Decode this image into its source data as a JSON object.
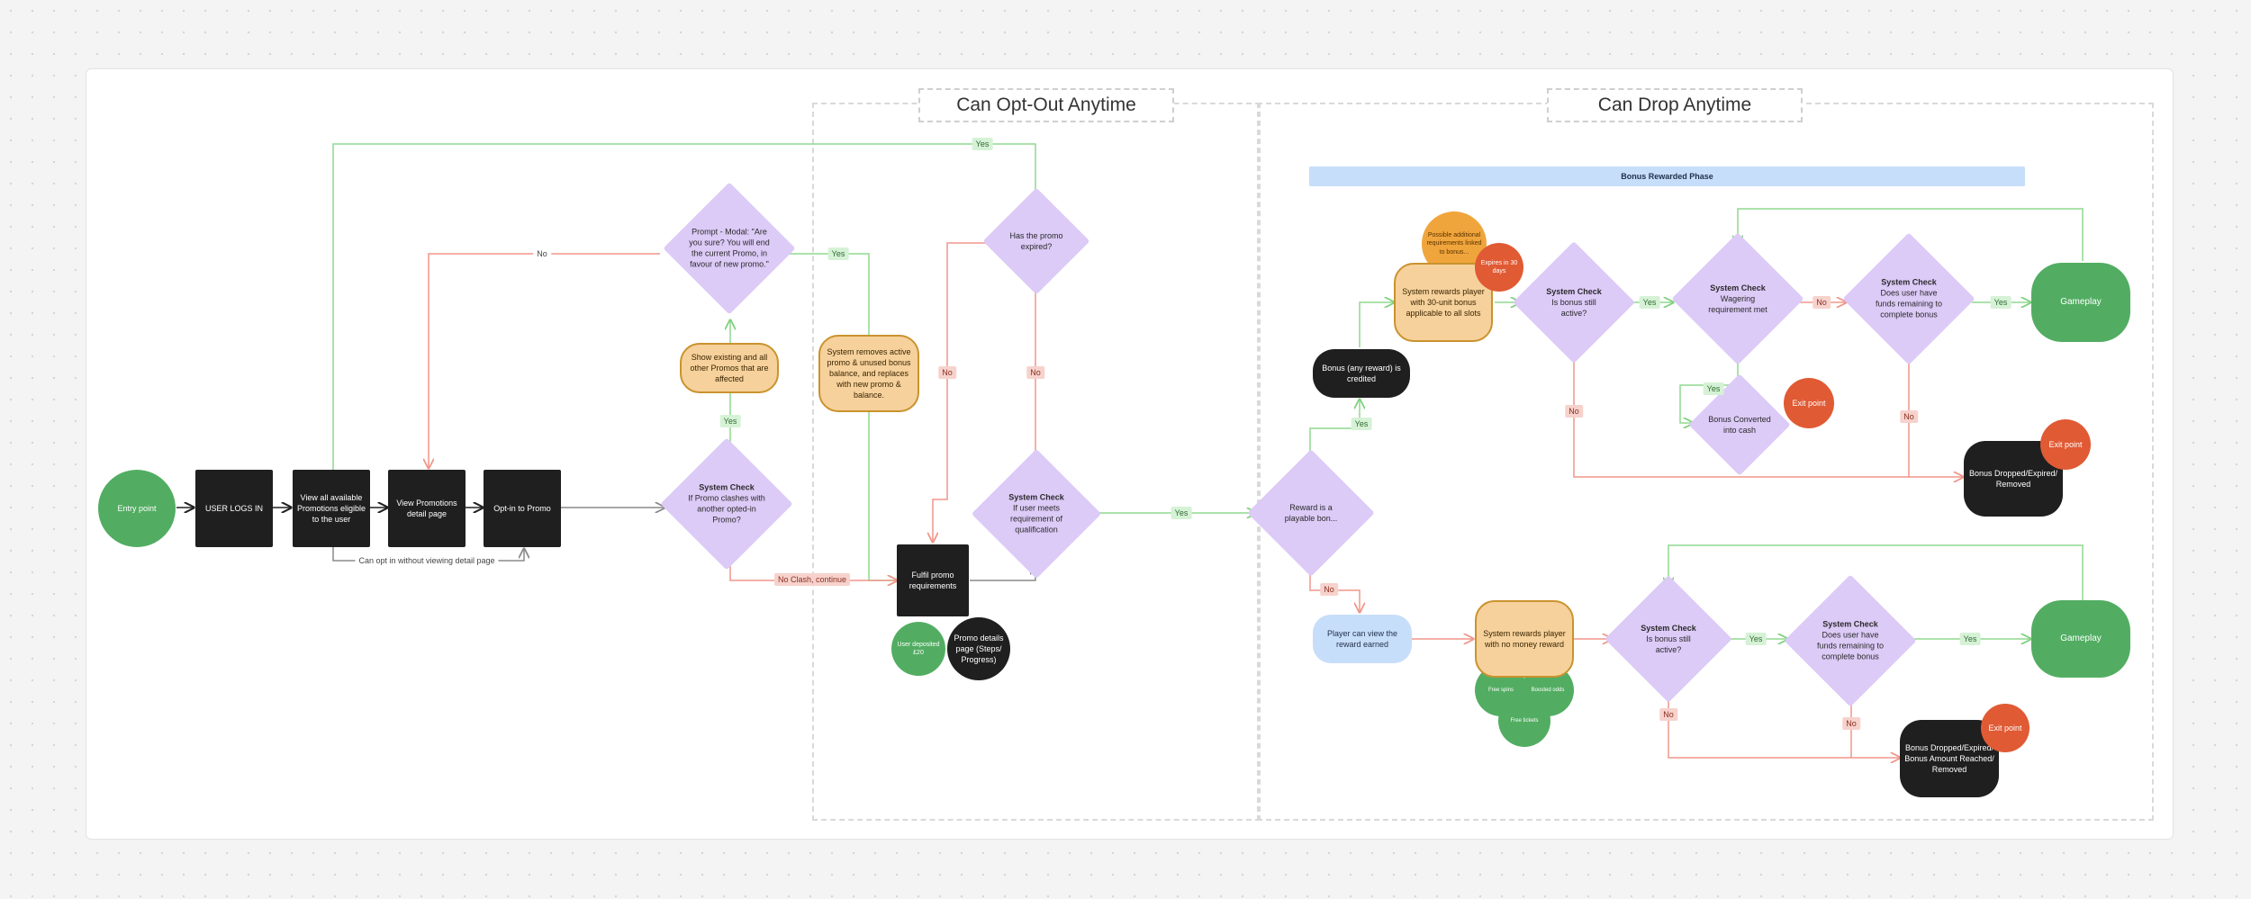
{
  "zones": {
    "optout": "Can Opt-Out Anytime",
    "drop": "Can Drop Anytime",
    "banner": "Bonus Rewarded Phase"
  },
  "nodes": {
    "entry": "Entry point",
    "login": "USER LOGS IN",
    "view_all": "View all available Promotions eligible to the user",
    "view_details": "View Promotions detail page",
    "optin": "Opt-in to Promo",
    "show_existing": "Show existing and all other Promos that are affected",
    "system_removes": "System removes active promo & unused bonus balance, and replaces with new promo & balance.",
    "fulfil": "Fulfil promo requirements",
    "user_deposited": "User deposited £20",
    "promo_details": "Promo details page (Steps/ Progress)",
    "bonus_credited": "Bonus (any reward) is credited",
    "possible_req": "Possible additional requirements linked to bonus...",
    "expires": "Expires in 30 days",
    "rewards_bonus": "System rewards player with 30-unit bonus applicable to all slots",
    "bonus_converted": "Bonus Converted into cash",
    "exit1": "Exit point",
    "gameplay1": "Gameplay",
    "dropped1": "Bonus Dropped/Expired/ Removed",
    "exit2": "Exit point",
    "player_view": "Player can view the reward earned",
    "rewards_nomoney": "System rewards player with no money reward",
    "free_spins": "Free spins",
    "boosted_odds": "Boosted odds",
    "free_tickets": "Free tickets",
    "gameplay2": "Gameplay",
    "dropped2": "Bonus Dropped/Expired/ Bonus Amount Reached/ Removed",
    "exit3": "Exit point"
  },
  "diamonds": {
    "prompt": "Prompt - Modal: \"Are you sure? You will end the current Promo, in favour of new promo.\"",
    "clash_title": "System Check",
    "clash": "If Promo clashes with another opted-in Promo?",
    "expired": "Has the promo expired?",
    "qual_title": "System Check",
    "qual": "If user meets requirement of qualification",
    "playable": "Reward is a playable bon...",
    "active1_title": "System Check",
    "active1": "Is bonus still active?",
    "wager_title": "System Check",
    "wager": "Wagering requirement met",
    "funds1_title": "System Check",
    "funds1": "Does user have funds remaining to complete bonus",
    "active2_title": "System Check",
    "active2": "Is bonus still active?",
    "funds2_title": "System Check",
    "funds2": "Does user have funds remaining to complete bonus"
  },
  "labels": {
    "yes_top": "Yes",
    "no_prompt": "No",
    "yes_prompt": "Yes",
    "yes_clash": "Yes",
    "noclash": "No Clash, continue",
    "no_left": "No",
    "no_right": "No",
    "yes_qual": "Yes",
    "yes_playable": "Yes",
    "no_playable": "No",
    "yes_active1": "Yes",
    "no_active1": "No",
    "no_wager": "No",
    "yes_wager": "Yes",
    "yes_funds1": "Yes",
    "no_funds1": "No",
    "yes_active2": "Yes",
    "no_active2": "No",
    "yes_funds2": "Yes",
    "no_funds2": "No",
    "optin_note": "Can opt in without viewing detail page"
  }
}
